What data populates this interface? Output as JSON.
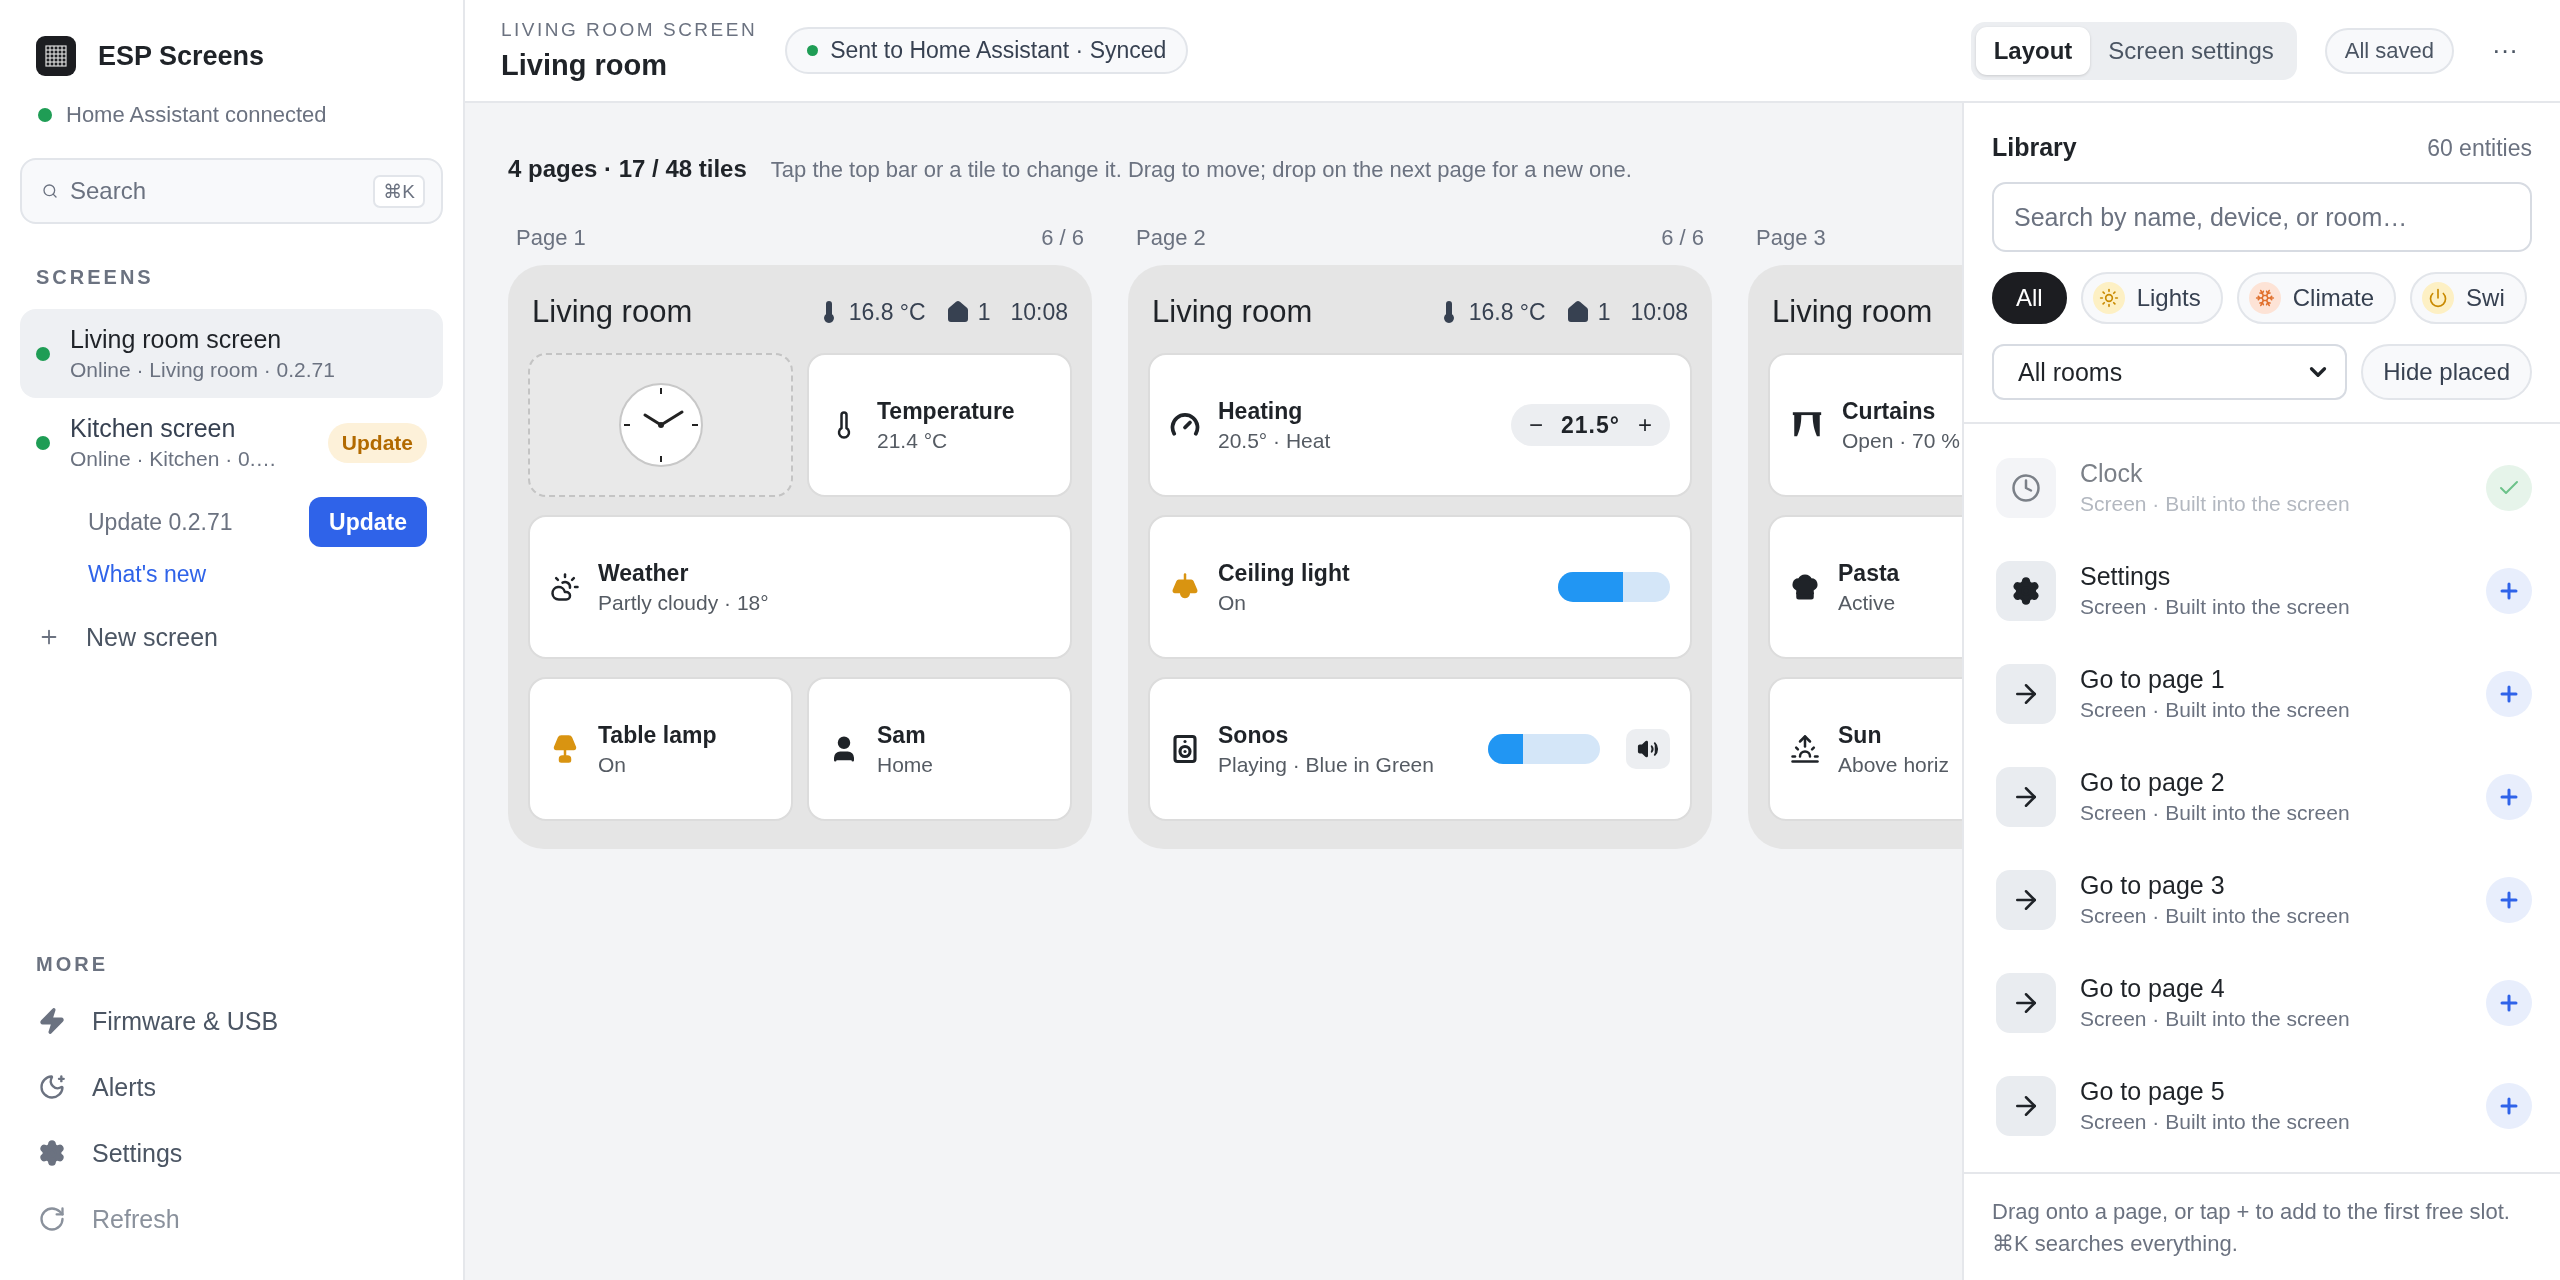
{
  "sidebar": {
    "app_name": "ESP Screens",
    "connection": {
      "label": "Home Assistant connected",
      "color": "#1f9d55"
    },
    "search": {
      "placeholder": "Search",
      "shortcut": "⌘K"
    },
    "screens_heading": "SCREENS",
    "screens": [
      {
        "name": "Living room screen",
        "subtitle": "Online · Living room · 0.2.71",
        "selected": true,
        "color": "#1f9d55"
      },
      {
        "name": "Kitchen screen",
        "subtitle": "Online · Kitchen · 0.…",
        "selected": false,
        "color": "#1f9d55",
        "badge": "Update"
      }
    ],
    "update": {
      "label": "Update 0.2.71",
      "button": "Update",
      "link": "What's new"
    },
    "new_screen": "New screen",
    "more_heading": "MORE",
    "more": [
      {
        "kind": "firmware",
        "label": "Firmware & USB",
        "disabled": false
      },
      {
        "kind": "alerts",
        "label": "Alerts",
        "disabled": false
      },
      {
        "kind": "settings",
        "label": "Settings",
        "disabled": false
      },
      {
        "kind": "refresh",
        "label": "Refresh",
        "disabled": true
      }
    ]
  },
  "header": {
    "eyebrow": "LIVING ROOM SCREEN",
    "title": "Living room",
    "status": {
      "label": "Sent to Home Assistant · Synced",
      "color": "#1f9d55"
    },
    "tabs": [
      {
        "label": "Layout",
        "selected": true
      },
      {
        "label": "Screen settings",
        "selected": false
      }
    ],
    "save_state": "All saved",
    "menu": "···"
  },
  "summary": {
    "count": "4 pages · 17 / 48 tiles",
    "hint": "Tap the top bar or a tile to change it. Drag to move; drop on the next page for a new one."
  },
  "pages": [
    {
      "label": "Page 1",
      "fill": "6 / 6",
      "title": "Living room",
      "temperature": "16.8 °C",
      "people": "1",
      "time": "10:08",
      "tiles": [
        {
          "kind": "clock",
          "wide": false
        },
        {
          "kind": "temperature",
          "wide": false,
          "name": "Temperature",
          "state": "21.4 °C"
        },
        {
          "kind": "weather",
          "wide": true,
          "name": "Weather",
          "state": "Partly cloudy · 18°"
        },
        {
          "kind": "lamp",
          "wide": false,
          "name": "Table lamp",
          "state": "On"
        },
        {
          "kind": "person",
          "wide": false,
          "name": "Sam",
          "state": "Home"
        }
      ]
    },
    {
      "label": "Page 2",
      "fill": "6 / 6",
      "title": "Living room",
      "temperature": "16.8 °C",
      "people": "1",
      "time": "10:08",
      "tiles": [
        {
          "kind": "heating",
          "wide": true,
          "name": "Heating",
          "state": "20.5° · Heat",
          "control": {
            "kind": "stepper",
            "value": "21.5°",
            "minus": "−",
            "plus": "+"
          }
        },
        {
          "kind": "light",
          "wide": true,
          "name": "Ceiling light",
          "state": "On",
          "control": {
            "kind": "slider",
            "level": 0.58
          }
        },
        {
          "kind": "speaker",
          "wide": true,
          "name": "Sonos",
          "state": "Playing · Blue in Green",
          "control": {
            "kind": "media",
            "level": 0.31
          }
        }
      ]
    },
    {
      "label": "Page 3",
      "title": "Living room",
      "tiles": [
        {
          "kind": "curtains",
          "wide": true,
          "name": "Curtains",
          "state": "Open · 70 %"
        },
        {
          "kind": "cooking",
          "wide": true,
          "name": "Pasta",
          "state": "Active"
        },
        {
          "kind": "sun",
          "wide": true,
          "name": "Sun",
          "state": "Above horiz"
        }
      ]
    }
  ],
  "library": {
    "title": "Library",
    "count": "60 entities",
    "search": {
      "placeholder": "Search by name, device, or room…"
    },
    "filters": [
      {
        "kind": "all",
        "label": "All",
        "selected": true
      },
      {
        "kind": "lights",
        "label": "Lights",
        "selected": false,
        "color": "#fdf0c4"
      },
      {
        "kind": "climate",
        "label": "Climate",
        "selected": false,
        "color": "#fde3d6"
      },
      {
        "kind": "switches",
        "label": "Swi",
        "selected": false,
        "color": "#fdf0c4"
      }
    ],
    "room": "All rooms",
    "hide_placed": "Hide placed",
    "items": [
      {
        "kind": "clock",
        "name": "Clock",
        "subtitle": "Screen · Built into the screen",
        "placed": true
      },
      {
        "kind": "settings",
        "name": "Settings",
        "subtitle": "Screen · Built into the screen",
        "placed": false
      },
      {
        "kind": "page",
        "name": "Go to page 1",
        "subtitle": "Screen · Built into the screen",
        "placed": false
      },
      {
        "kind": "page",
        "name": "Go to page 2",
        "subtitle": "Screen · Built into the screen",
        "placed": false
      },
      {
        "kind": "page",
        "name": "Go to page 3",
        "subtitle": "Screen · Built into the screen",
        "placed": false
      },
      {
        "kind": "page",
        "name": "Go to page 4",
        "subtitle": "Screen · Built into the screen",
        "placed": false
      },
      {
        "kind": "page",
        "name": "Go to page 5",
        "subtitle": "Screen · Built into the screen",
        "placed": false
      }
    ],
    "footer": "Drag onto a page, or tap + to add to the first free slot. ⌘K searches everything."
  }
}
